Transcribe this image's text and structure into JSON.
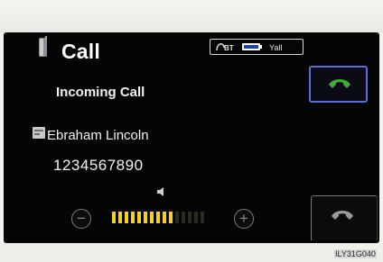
{
  "header": {
    "title": "Call"
  },
  "status": {
    "bluetooth_label": "BT",
    "battery_icon": "battery-icon",
    "signal_label": "Yall"
  },
  "call": {
    "status_text": "Incoming Call",
    "contact_name": "Ebraham Lincoln",
    "phone_number": "1234567890"
  },
  "controls": {
    "answer_icon": "answer-call-icon",
    "end_icon": "end-call-icon",
    "volume_minus": "−",
    "volume_plus": "+",
    "volume_level": 10,
    "volume_max": 15
  },
  "colors": {
    "answer_green": "#3fa83a",
    "active_segment": "#f3d21a",
    "inactive_segment": "#2a2a1e",
    "highlight_border": "#5a6fd6"
  },
  "watermark": "ILY31G040"
}
